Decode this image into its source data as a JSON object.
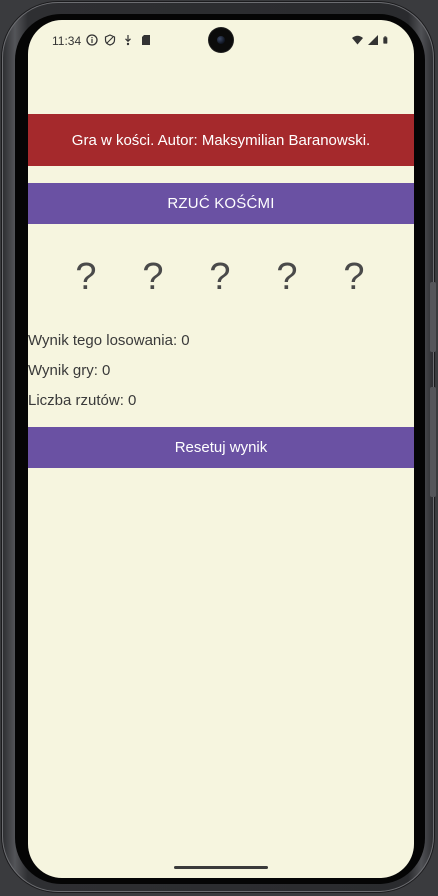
{
  "status_bar": {
    "time": "11:34",
    "left_icons": [
      "info-icon",
      "shield-icon",
      "download-icon",
      "sd-card-icon"
    ],
    "right_icons": [
      "wifi-icon",
      "signal-icon",
      "battery-icon"
    ]
  },
  "banner": {
    "text": "Gra w kości. Autor: Maksymilian Baranowski."
  },
  "roll_button": {
    "label": "RZUĆ KOŚĆMI"
  },
  "dice": [
    "?",
    "?",
    "?",
    "?",
    "?"
  ],
  "stats": {
    "draw_result": "Wynik tego losowania: 0",
    "game_result": "Wynik gry: 0",
    "roll_count": "Liczba rzutów: 0"
  },
  "reset_button": {
    "label": "Resetuj wynik"
  },
  "colors": {
    "background": "#f6f5df",
    "banner": "#a5292c",
    "button": "#6a51a3",
    "text": "#3a3a3a"
  }
}
